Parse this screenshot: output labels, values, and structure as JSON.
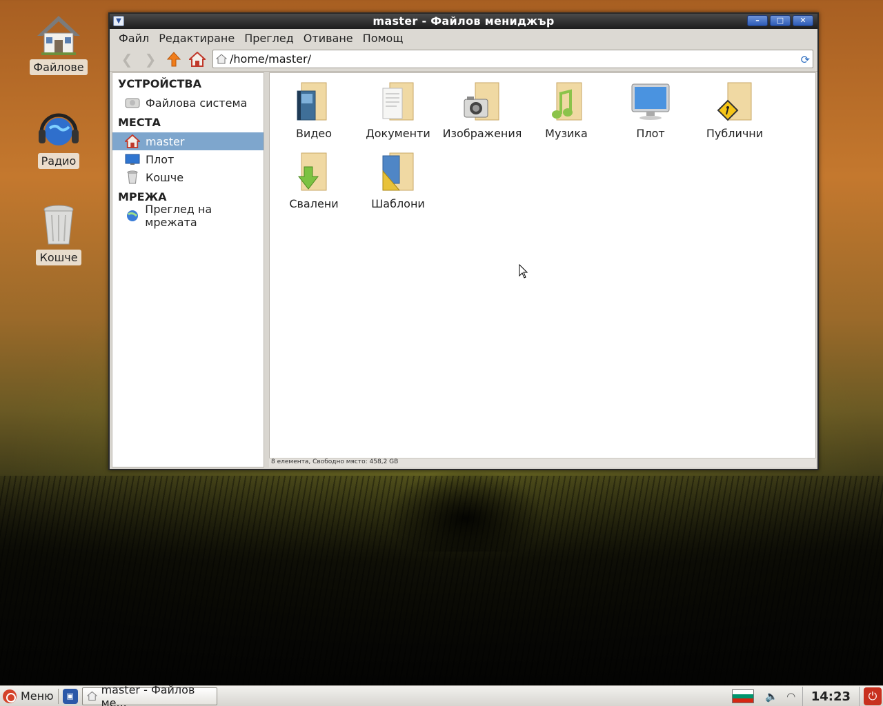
{
  "desktop": {
    "icons": [
      {
        "label": "Файлове",
        "icon": "home-icon"
      },
      {
        "label": "Радио",
        "icon": "headphones-globe-icon"
      },
      {
        "label": "Кошче",
        "icon": "trash-icon"
      }
    ]
  },
  "window": {
    "title": "master - Файлов мениджър",
    "menu": [
      "Файл",
      "Редактиране",
      "Преглед",
      "Отиване",
      "Помощ"
    ],
    "address": "/home/master/",
    "sidebar": {
      "devices_heading": "УСТРОЙСТВА",
      "devices": [
        {
          "label": "Файлова система",
          "icon": "harddisk-icon"
        }
      ],
      "places_heading": "МЕСТА",
      "places": [
        {
          "label": "master",
          "icon": "home-icon",
          "selected": true
        },
        {
          "label": "Плот",
          "icon": "desktop-icon"
        },
        {
          "label": "Кошче",
          "icon": "trash-icon"
        }
      ],
      "network_heading": "МРЕЖА",
      "network": [
        {
          "label": "Преглед на мрежата",
          "icon": "network-icon"
        }
      ]
    },
    "files": [
      {
        "name": "Видео",
        "icon": "video-folder-icon"
      },
      {
        "name": "Документи",
        "icon": "documents-folder-icon"
      },
      {
        "name": "Изображения",
        "icon": "pictures-folder-icon"
      },
      {
        "name": "Музика",
        "icon": "music-folder-icon"
      },
      {
        "name": "Плот",
        "icon": "desktop-folder-icon"
      },
      {
        "name": "Публични",
        "icon": "public-folder-icon"
      },
      {
        "name": "Свалени",
        "icon": "downloads-folder-icon"
      },
      {
        "name": "Шаблони",
        "icon": "templates-folder-icon"
      }
    ],
    "status": "8 елемента, Свободно място: 458,2 GB"
  },
  "taskbar": {
    "menu_label": "Меню",
    "task_label": "master - Файлов ме...",
    "clock": "14:23"
  },
  "colors": {
    "selection": "#7ea6cd",
    "folder": "#f0d9a3",
    "title_bar": "#2a2a2a"
  }
}
